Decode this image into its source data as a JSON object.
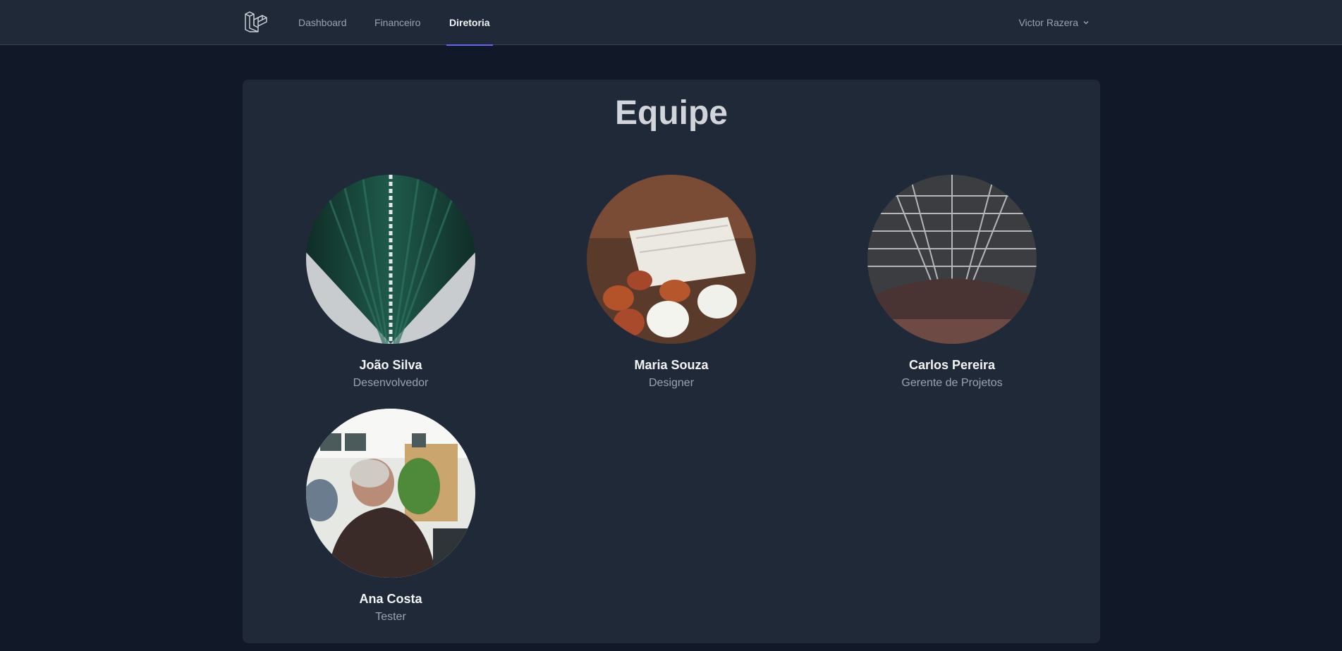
{
  "nav": {
    "links": [
      "Dashboard",
      "Financeiro",
      "Diretoria"
    ],
    "active": "Diretoria",
    "user_name": "Victor Razera"
  },
  "page": {
    "title": "Equipe"
  },
  "team": [
    {
      "name": "João Silva",
      "role": "Desenvolvedor"
    },
    {
      "name": "Maria Souza",
      "role": "Designer"
    },
    {
      "name": "Carlos Pereira",
      "role": "Gerente de Projetos"
    },
    {
      "name": "Ana Costa",
      "role": "Tester"
    }
  ],
  "colors": {
    "background": "#111827",
    "surface": "#1f2937",
    "accent": "#6366f1",
    "text_primary": "#f3f4f6",
    "text_muted": "#9ca3af"
  }
}
